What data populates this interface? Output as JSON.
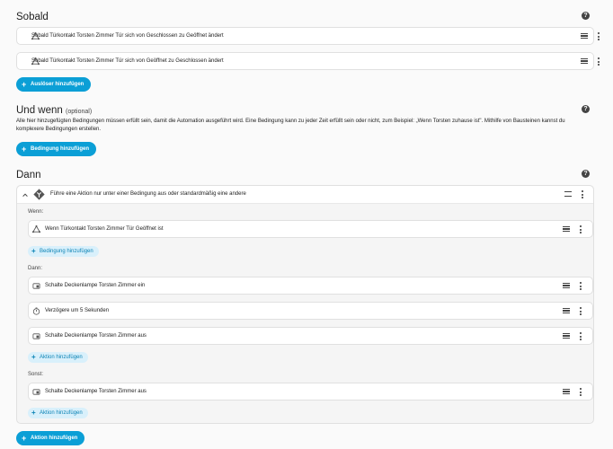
{
  "sections": {
    "sobald": {
      "title": "Sobald",
      "triggers": [
        "Sobald Türkontakt Torsten Zimmer Tür sich von Geschlossen zu Geöffnet ändert",
        "Sobald Türkontakt Torsten Zimmer Tür sich von Geöffnet zu Geschlossen ändert"
      ],
      "add_label": "Auslöser hinzufügen"
    },
    "und_wenn": {
      "title": "Und wenn",
      "optional": "(optional)",
      "description": "Alle hier hinzugefügten Bedingungen müssen erfüllt sein, damit die Automation ausgeführt wird. Eine Bedingung kann zu jeder Zeit erfüllt sein oder nicht, zum Beispiel: „Wenn Torsten zuhause ist\". Mithilfe von Bausteinen kannst du komplexere Bedingungen erstellen.",
      "add_label": "Bedingung hinzufügen"
    },
    "dann": {
      "title": "Dann",
      "choose_title": "Führe eine Aktion nur unter einer Bedingung aus oder standardmäßig eine andere",
      "wenn_label": "Wenn:",
      "wenn_condition": "Wenn Türkontakt Torsten Zimmer Tür Geöffnet ist",
      "add_condition_label": "Bedingung hinzufügen",
      "dann_label": "Dann:",
      "dann_actions": [
        "Schalte Deckenlampe Torsten Zimmer ein",
        "Verzögere um 5 Sekunden",
        "Schalte Deckenlampe Torsten Zimmer aus"
      ],
      "add_action_label": "Aktion hinzufügen",
      "sonst_label": "Sonst:",
      "sonst_actions": [
        "Schalte Deckenlampe Torsten Zimmer aus"
      ],
      "add_action_label_2": "Aktion hinzufügen",
      "add_main_action_label": "Aktion hinzufügen"
    }
  },
  "help_icon": "?",
  "colors": {
    "accent": "#0b9fd6",
    "accent_soft": "#d9f0fb"
  }
}
